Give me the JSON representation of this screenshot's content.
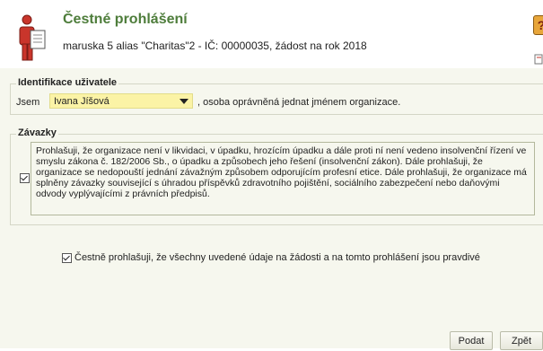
{
  "header": {
    "title": "Čestné prohlášení",
    "subtitle": "maruska 5 alias \"Charitas\"2 - IČ: 00000035, žádost na rok 2018",
    "help_icon": "help-icon",
    "person_icon": "person-document-icon"
  },
  "identifikace": {
    "legend": "Identifikace uživatele",
    "jsem": "Jsem",
    "selected_user": "Ivana Jíšová",
    "suffix": ", osoba oprávněná jednat jménem organizace."
  },
  "zavazky": {
    "legend": "Závazky",
    "checked": true,
    "text": "Prohlašuji, že organizace není v likvidaci, v úpadku, hrozícím úpadku a dále proti ní není vedeno insolvenční řízení ve smyslu zákona č. 182/2006 Sb., o úpadku a způsobech jeho řešení (insolvenční zákon). Dále prohlašuji, že organizace se nedopouští jednání závažným způsobem odporujícím profesní etice. Dále prohlašuji, že organizace má splněny závazky související s úhradou příspěvků zdravotního pojištění, sociálního zabezpečení nebo daňovými odvody vyplývajícími z právních předpisů."
  },
  "cestne": {
    "checked": true,
    "label": "Čestně prohlašuji, že všechny uvedené údaje na žádosti a na tomto prohlášení jsou pravdivé"
  },
  "buttons": {
    "podat": "Podat",
    "zpet": "Zpět"
  },
  "colors": {
    "title": "#4e7d3b",
    "select_bg": "#fbf3a6",
    "panel_bg": "#f6f7ee"
  }
}
